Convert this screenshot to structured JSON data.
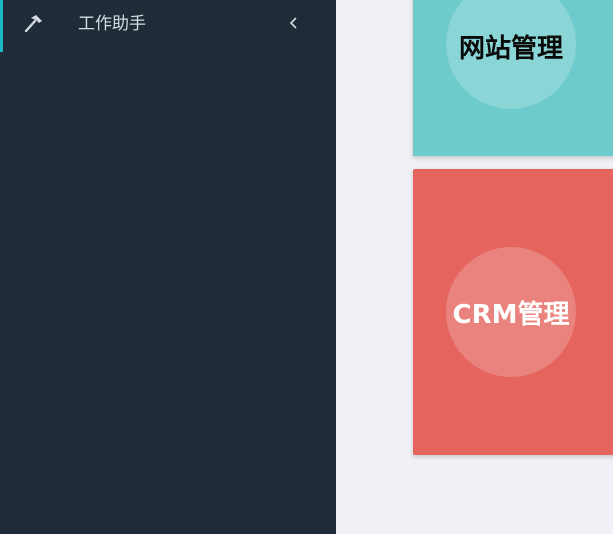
{
  "sidebar": {
    "menu": {
      "label": "工作助手",
      "icon": "hammer-icon",
      "collapse_icon": "chevron-left-icon",
      "accent": "#1ab7c4"
    }
  },
  "tiles": [
    {
      "label": "网站管理",
      "color": "#6dcbcb"
    },
    {
      "label": "CRM管理",
      "color": "#e5645d"
    }
  ]
}
